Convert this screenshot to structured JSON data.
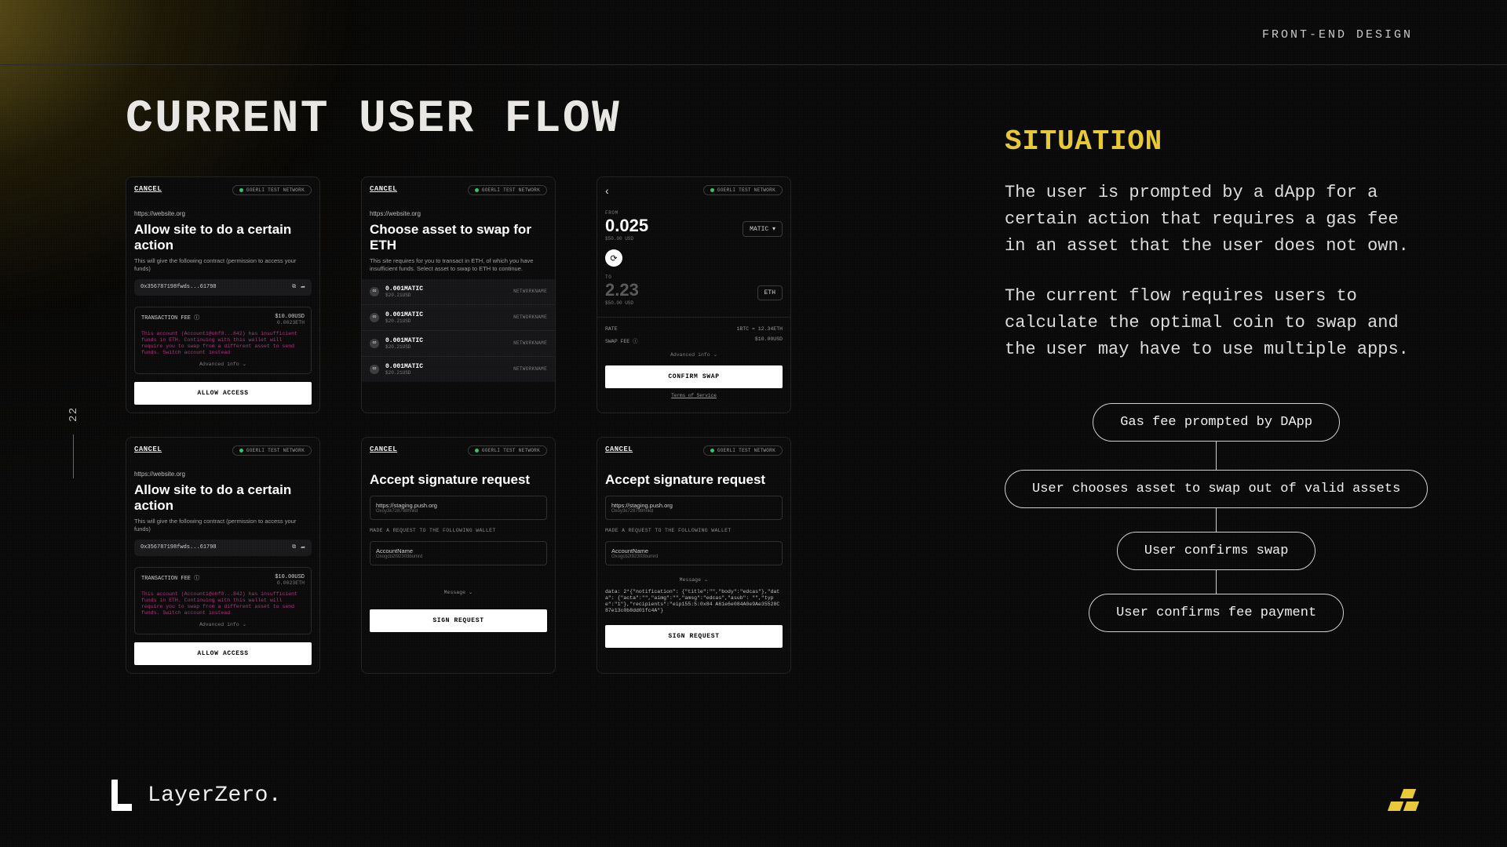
{
  "header": {
    "top_label": "FRONT-END DESIGN",
    "title": "CURRENT USER FLOW"
  },
  "page_number": "22",
  "brand": "LayerZero.",
  "situation": {
    "heading": "SITUATION",
    "para1": "The user is prompted by a dApp for a certain action that requires a gas fee in an asset that the user does not own.",
    "para2": "The current flow requires users to calculate the optimal coin to swap and the user may have to use multiple apps."
  },
  "flow_steps": [
    "Gas fee prompted by DApp",
    "User chooses asset to swap out of valid assets",
    "User confirms swap",
    "User confirms fee payment"
  ],
  "mocks": {
    "cancel": "CANCEL",
    "network": "GOERLI TEST NETWORK",
    "site": "https://website.org",
    "allow": {
      "title": "Allow site to do a certain action",
      "sub": "This will give the following contract (permission to access your funds)",
      "addr": "0x356787198fwds...61798",
      "fee_label": "TRANSACTION FEE ⓘ",
      "fee_usd": "$10.00USD",
      "fee_eth": "0.0023ETH",
      "warn": "This account (Account1@ohf0...842) has insufficient funds in ETH. Continuing with this wallet will require you to swap from a different asset to send funds. Switch account instead",
      "advanced": "Advanced info ⌄",
      "btn": "ALLOW ACCESS"
    },
    "choose": {
      "title": "Choose asset to swap for ETH",
      "sub": "This site requires for you to transact in ETH, of which you have insufficient funds. Select asset to swap to ETH to continue.",
      "assets": [
        {
          "name": "0.001MATIC",
          "usd": "$20.21USD",
          "net": "NETWORKNAME"
        },
        {
          "name": "0.001MATIC",
          "usd": "$20.21USD",
          "net": "NETWORKNAME"
        },
        {
          "name": "0.001MATIC",
          "usd": "$20.21USD",
          "net": "NETWORKNAME"
        },
        {
          "name": "0.001MATIC",
          "usd": "$20.21USD",
          "net": "NETWORKNAME"
        }
      ]
    },
    "swap": {
      "from_label": "FROM",
      "from_amt": "0.025",
      "from_usd": "$50.00 USD",
      "from_coin": "MATIC ▾",
      "to_label": "TO",
      "to_amt": "2.23",
      "to_usd": "$50.00 USD",
      "to_coin": "ETH",
      "rate_label": "RATE",
      "rate_val": "1BTC = 12.34ETH",
      "fee_label": "SWAP FEE ⓘ",
      "fee_val": "$10.00USD",
      "advanced": "Advanced info ⌄",
      "btn": "CONFIRM SWAP",
      "tos": "Terms of Service"
    },
    "sig": {
      "title": "Accept signature request",
      "url": "https://staging.push.org",
      "url_sub": "Oxoy3k728798hnkd",
      "label": "MADE A REQUEST TO THE FOLLOWING WALLET",
      "acct": "AccountName",
      "acct_sub": "Oxogcb2t92303bumrd",
      "msg": "Message ⌄",
      "btn": "SIGN REQUEST",
      "json": "data:\n2*{\"notification\":\n{\"title\":\"\",\"body\":\"edcas\"},\"data\":\n{\"acta\":\"\",\"aimg\":\"\",\"amsg\":\"edcas\",\"asub\":\n\"\",\"type\":\"1\"},\"recipients\":\"eip155:5:0x84\nA61e6e084A0e9Ae35528C87e13c0b8dd01fc4A\"}"
    }
  }
}
